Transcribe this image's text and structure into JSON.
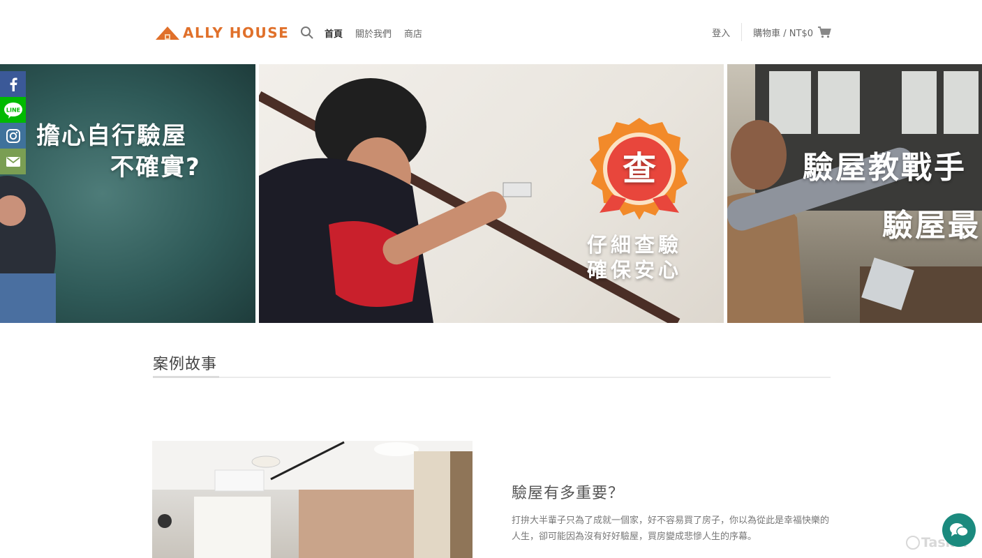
{
  "header": {
    "logo_text": "ALLY HOUSE",
    "brand_color": "#e0702a",
    "search_icon": "search-icon",
    "nav": [
      {
        "label": "首頁",
        "active": true
      },
      {
        "label": "關於我們",
        "active": false
      },
      {
        "label": "商店",
        "active": false
      }
    ],
    "login_label": "登入",
    "cart_label": "購物車 / NT$0",
    "cart_icon": "cart-icon"
  },
  "social": [
    {
      "name": "facebook-icon",
      "color": "#3b5998"
    },
    {
      "name": "line-icon",
      "label": "LINE",
      "color": "#00b900"
    },
    {
      "name": "instagram-icon",
      "color": "#3f729b"
    },
    {
      "name": "email-icon",
      "color": "#7a9e53"
    }
  ],
  "slider": {
    "slide1": {
      "line1": "擔心自行驗屋",
      "line2": "不確實?"
    },
    "slide2": {
      "badge_char": "查",
      "line1": "仔細查驗",
      "line2": "確保安心"
    },
    "slide3": {
      "line1": "驗屋教戰手",
      "line2": "驗屋最"
    }
  },
  "section": {
    "title": "案例故事"
  },
  "case": {
    "title": "驗屋有多重要？",
    "text": "打拚大半輩子只為了成就一個家，好不容易買了房子，你以為從此是幸福快樂的人生，卻可能因為沒有好好驗屋，買房變成悲慘人生的序幕。"
  },
  "watermark": {
    "text": "Tasker"
  },
  "chat": {
    "icon": "chat-icon",
    "color": "#1b8a7e"
  }
}
